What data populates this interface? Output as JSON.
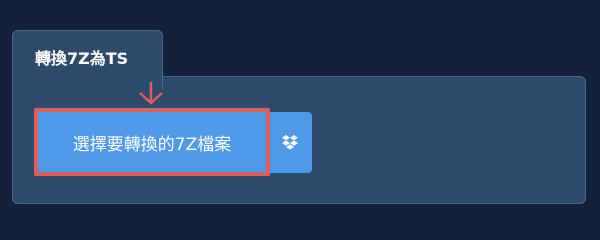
{
  "tab": {
    "title": "轉換7Z為TS"
  },
  "actions": {
    "select_file_label": "選擇要轉換的7Z檔案",
    "dropbox_icon": "dropbox-icon"
  },
  "colors": {
    "page_background": "#13223a",
    "panel_background": "#2d4a6b",
    "button_blue": "#4f9ae8",
    "highlight_red": "#d9605c"
  }
}
